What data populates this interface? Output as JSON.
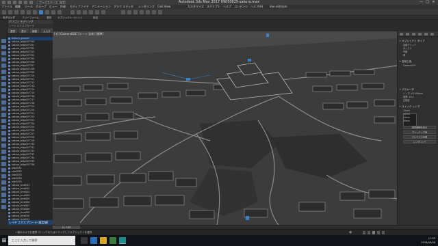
{
  "window": {
    "title": "Autodesk 3ds Max 2017    09050825-sakura.max",
    "workspace": "ワークスペース: 既定",
    "controls": [
      "—",
      "□",
      "✕"
    ],
    "qa_icons": [
      "new-file-icon",
      "open-icon",
      "save-icon",
      "undo-icon",
      "redo-icon",
      "project-icon"
    ]
  },
  "menu": {
    "items": [
      "ファイル",
      "編集",
      "ツール",
      "グループ",
      "ビュー",
      "作成",
      "モディファイヤ",
      "アニメーション",
      "グラフ エディタ",
      "レンダリング",
      "Civil View",
      "カスタマイズ",
      "スクリプト",
      "ヘルプ",
      "コンテンツ",
      "ヘルプ(H)",
      "Vue xStream"
    ]
  },
  "ribbon": {
    "tabs": [
      "モデリング",
      "フリーフォーム",
      "選択",
      "オブジェクト ペイント",
      "設定"
    ],
    "active": 0
  },
  "scene_explorer": {
    "title": "ポリゴン モデリング",
    "subtitle": "シーン エクスプローラ",
    "tools": [
      "選択",
      "表示",
      "編集",
      "カスタマイズ"
    ],
    "objects": [
      "Sakura_ground",
      "sakura_bldg007700",
      "sakura_bldg007701",
      "sakura_bldg007702",
      "sakura_bldg007703",
      "sakura_bldg007704",
      "sakura_bldg007705",
      "sakura_bldg007706",
      "sakura_bldg007707",
      "sakura_bldg007708",
      "sakura_bldg007709",
      "sakura_bldg007710",
      "sakura_bldg007711",
      "sakura_bldg007712",
      "sakura_bldg007713",
      "sakura_bldg007714",
      "sakura_bldg007715",
      "sakura_bldg007716",
      "sakura_bldg007717",
      "sakura_bldg007718",
      "sakura_bldg007719",
      "sakura_bldg007720",
      "sakura_bldg007721",
      "sakura_bldg007722",
      "sakura_bldg007723",
      "sakura_bldg007724",
      "sakura_bldg007725",
      "sakura_bldg007726",
      "sakura_bldg007727",
      "sakura_bldg007728",
      "sakura_bldg007729",
      "sakura_bldg007730",
      "sakura_bldg007731",
      "sakura_bldg007732",
      "sakura_bldg007733",
      "sakura_bldg007734",
      "sakura_bldg007735",
      "sakura_bldg007736",
      "site2831",
      "site2832",
      "site2833",
      "site2834",
      "site2835",
      "sakura_tree001",
      "sakura_tree002",
      "sakura_tree003",
      "sakura_tree004",
      "sakura_tree005",
      "sakura_tree006",
      "sakura_tree007",
      "sakura_tree008",
      "sakura_tree009",
      "sakura_tree010",
      "sakura_tree011"
    ],
    "footer": "レイヤ エクスプローラ (既定値)"
  },
  "viewport": {
    "label": "[+] [Camera001] [シーン 全体] [標準]"
  },
  "command_panel": {
    "sections": [
      {
        "title": "+ オブジェクト タイプ",
        "props": [
          "自動グリッド",
          "ボックス",
          "円錐",
          "球"
        ]
      },
      {
        "title": "+ 名前と色",
        "props": [
          "Camera001"
        ]
      },
      {
        "title": "+ パラメータ",
        "props": [
          "レンズ: 43.456mm",
          "視野: 45.0",
          "正投影"
        ]
      },
      {
        "title": "+ ストック レンズ",
        "props": [
          "15mm",
          "20mm",
          "24mm",
          "28mm"
        ]
      }
    ],
    "buttons": [
      "環境範囲を表示",
      "クリッピング面",
      "マルチパス効果",
      "レンダリング"
    ]
  },
  "timeline": {
    "slider": "0 / 100"
  },
  "status": {
    "text": "1 個のカメラを選択  クリックまたはドラッグしてオブジェクトを選択",
    "key": "+"
  },
  "taskbar": {
    "search_placeholder": "ここに入力して検索",
    "time": "17:02",
    "date": "2018/09/06"
  },
  "colors": {
    "selection": "#3a82c8",
    "grid": "#5a5a5a",
    "building": "#9a9a9a",
    "castle": "#c0b8b8"
  }
}
